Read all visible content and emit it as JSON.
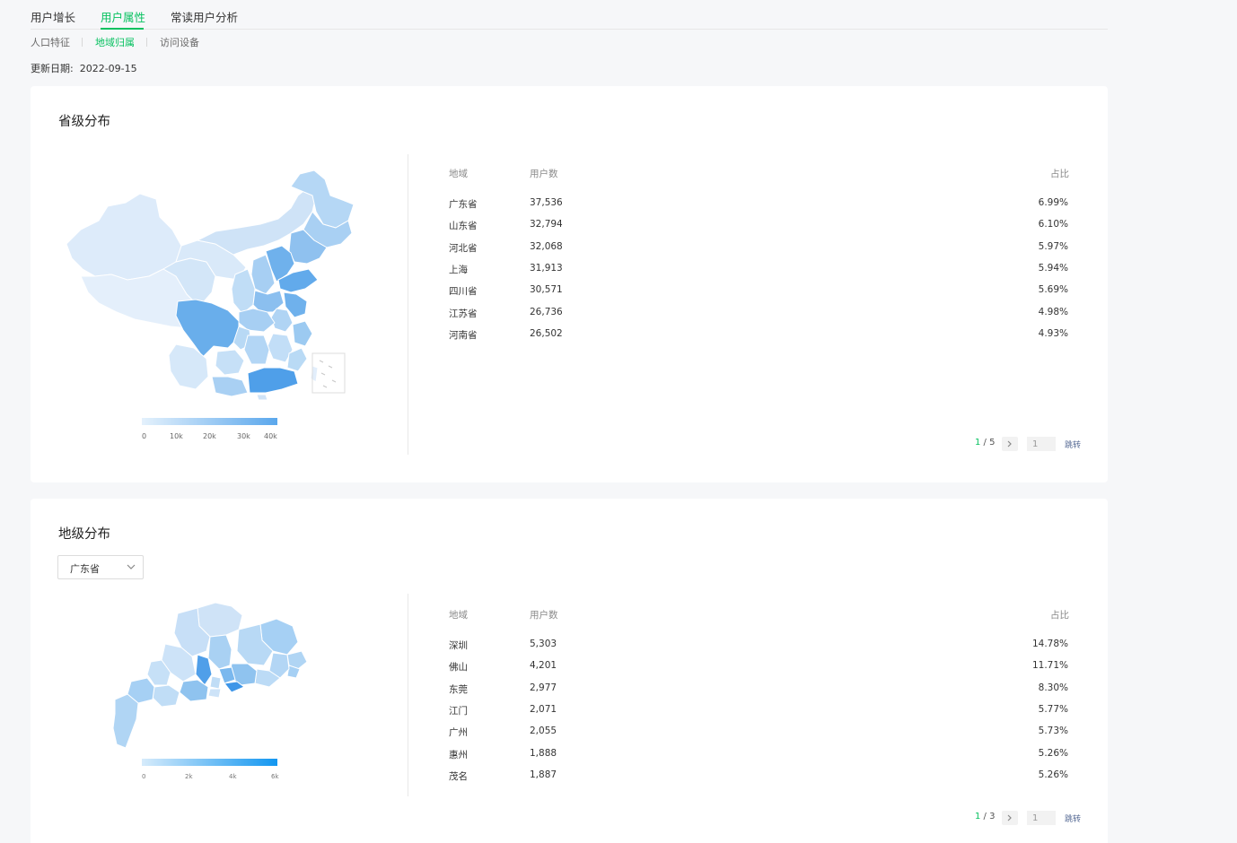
{
  "top_tabs": [
    "用户增长",
    "用户属性",
    "常读用户分析"
  ],
  "sub_tabs": [
    "人口特征",
    "地域归属",
    "访问设备"
  ],
  "update_label": "更新日期:",
  "update_date": "2022-09-15",
  "province_section": {
    "title": "省级分布",
    "headers": {
      "region": "地域",
      "users": "用户数",
      "ratio": "占比"
    },
    "rows": [
      {
        "region": "广东省",
        "users": "37,536",
        "ratio": "6.99%"
      },
      {
        "region": "山东省",
        "users": "32,794",
        "ratio": "6.10%"
      },
      {
        "region": "河北省",
        "users": "32,068",
        "ratio": "5.97%"
      },
      {
        "region": "上海",
        "users": "31,913",
        "ratio": "5.94%"
      },
      {
        "region": "四川省",
        "users": "30,571",
        "ratio": "5.69%"
      },
      {
        "region": "江苏省",
        "users": "26,736",
        "ratio": "4.98%"
      },
      {
        "region": "河南省",
        "users": "26,502",
        "ratio": "4.93%"
      }
    ],
    "pagination": {
      "current": "1",
      "total": "5",
      "input_value": "1",
      "jump_label": "跳转"
    },
    "legend": {
      "ticks": [
        "0",
        "10k",
        "20k",
        "30k",
        "40k"
      ],
      "color_min": "#e4f1fc",
      "color_max": "#5aa7ec"
    }
  },
  "city_section": {
    "title": "地级分布",
    "select_value": "广东省",
    "headers": {
      "region": "地域",
      "users": "用户数",
      "ratio": "占比"
    },
    "rows": [
      {
        "region": "深圳",
        "users": "5,303",
        "ratio": "14.78%"
      },
      {
        "region": "佛山",
        "users": "4,201",
        "ratio": "11.71%"
      },
      {
        "region": "东莞",
        "users": "2,977",
        "ratio": "8.30%"
      },
      {
        "region": "江门",
        "users": "2,071",
        "ratio": "5.77%"
      },
      {
        "region": "广州",
        "users": "2,055",
        "ratio": "5.73%"
      },
      {
        "region": "惠州",
        "users": "1,888",
        "ratio": "5.26%"
      },
      {
        "region": "茂名",
        "users": "1,887",
        "ratio": "5.26%"
      }
    ],
    "pagination": {
      "current": "1",
      "total": "3",
      "input_value": "1",
      "jump_label": "跳转"
    },
    "legend": {
      "ticks": [
        "0",
        "2k",
        "4k",
        "6k"
      ],
      "color_min": "#d6ebfb",
      "color_max": "#1296f0"
    }
  },
  "icons": {
    "next_page": "chevron-right-icon",
    "dropdown": "chevron-down-icon"
  },
  "colors": {
    "accent": "#07c160",
    "map_light": "#d9eafb",
    "map_mid": "#a4cef3",
    "map_dark": "#5ba8ec",
    "link": "#576b95"
  }
}
